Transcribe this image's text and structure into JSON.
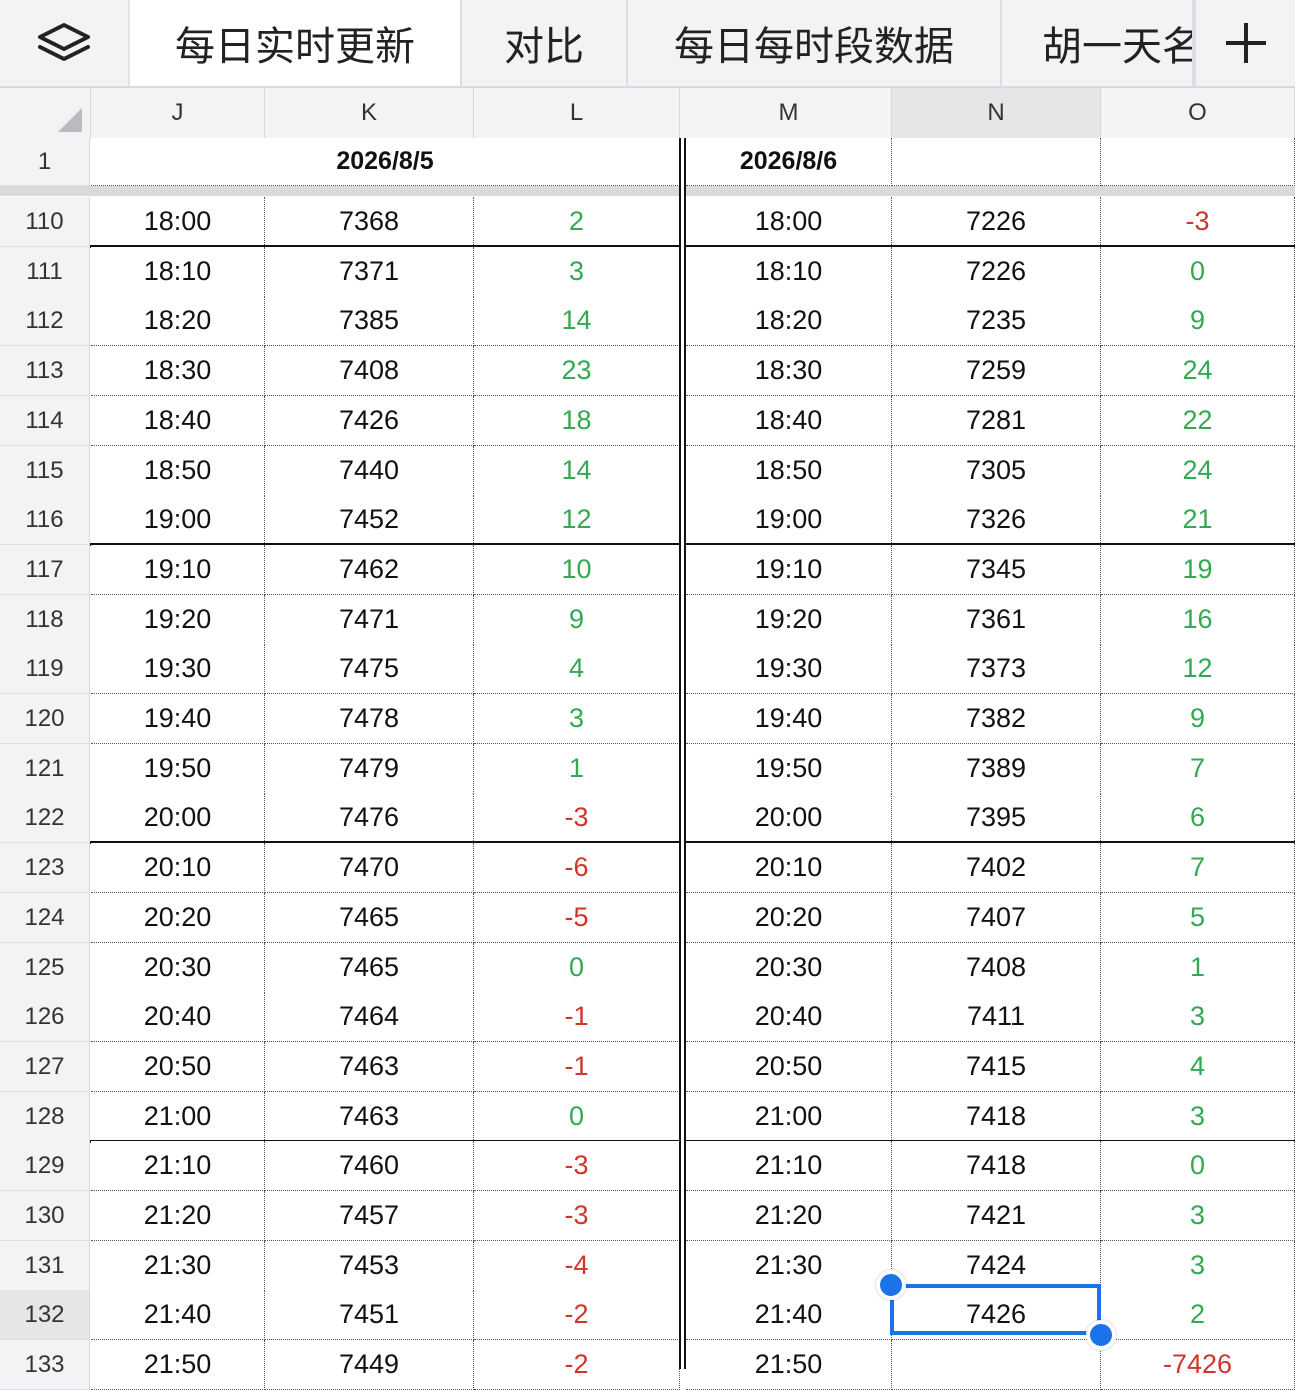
{
  "tabs": [
    {
      "label": "每日实时更新",
      "active": true
    },
    {
      "label": "对比",
      "active": false
    },
    {
      "label": "每日每时段数据",
      "active": false
    },
    {
      "label": "胡一天名",
      "active": false
    }
  ],
  "toolbar": {
    "menu_icon": "layers-icon",
    "add_icon": "plus-icon"
  },
  "columns": [
    "J",
    "K",
    "L",
    "M",
    "N",
    "O"
  ],
  "selected_column": "N",
  "selected_row": "132",
  "header_row": {
    "num": "1",
    "date1": "2026/8/5",
    "date2": "2026/8/6"
  },
  "rows": [
    {
      "num": "110",
      "t1": "18:00",
      "v1": "7368",
      "d1": "2",
      "t2": "18:00",
      "v2": "7226",
      "d2": "-3"
    },
    {
      "num": "111",
      "t1": "18:10",
      "v1": "7371",
      "d1": "3",
      "t2": "18:10",
      "v2": "7226",
      "d2": "0"
    },
    {
      "num": "112",
      "t1": "18:20",
      "v1": "7385",
      "d1": "14",
      "t2": "18:20",
      "v2": "7235",
      "d2": "9"
    },
    {
      "num": "113",
      "t1": "18:30",
      "v1": "7408",
      "d1": "23",
      "t2": "18:30",
      "v2": "7259",
      "d2": "24"
    },
    {
      "num": "114",
      "t1": "18:40",
      "v1": "7426",
      "d1": "18",
      "t2": "18:40",
      "v2": "7281",
      "d2": "22"
    },
    {
      "num": "115",
      "t1": "18:50",
      "v1": "7440",
      "d1": "14",
      "t2": "18:50",
      "v2": "7305",
      "d2": "24"
    },
    {
      "num": "116",
      "t1": "19:00",
      "v1": "7452",
      "d1": "12",
      "t2": "19:00",
      "v2": "7326",
      "d2": "21"
    },
    {
      "num": "117",
      "t1": "19:10",
      "v1": "7462",
      "d1": "10",
      "t2": "19:10",
      "v2": "7345",
      "d2": "19"
    },
    {
      "num": "118",
      "t1": "19:20",
      "v1": "7471",
      "d1": "9",
      "t2": "19:20",
      "v2": "7361",
      "d2": "16"
    },
    {
      "num": "119",
      "t1": "19:30",
      "v1": "7475",
      "d1": "4",
      "t2": "19:30",
      "v2": "7373",
      "d2": "12"
    },
    {
      "num": "120",
      "t1": "19:40",
      "v1": "7478",
      "d1": "3",
      "t2": "19:40",
      "v2": "7382",
      "d2": "9"
    },
    {
      "num": "121",
      "t1": "19:50",
      "v1": "7479",
      "d1": "1",
      "t2": "19:50",
      "v2": "7389",
      "d2": "7"
    },
    {
      "num": "122",
      "t1": "20:00",
      "v1": "7476",
      "d1": "-3",
      "t2": "20:00",
      "v2": "7395",
      "d2": "6"
    },
    {
      "num": "123",
      "t1": "20:10",
      "v1": "7470",
      "d1": "-6",
      "t2": "20:10",
      "v2": "7402",
      "d2": "7"
    },
    {
      "num": "124",
      "t1": "20:20",
      "v1": "7465",
      "d1": "-5",
      "t2": "20:20",
      "v2": "7407",
      "d2": "5"
    },
    {
      "num": "125",
      "t1": "20:30",
      "v1": "7465",
      "d1": "0",
      "t2": "20:30",
      "v2": "7408",
      "d2": "1"
    },
    {
      "num": "126",
      "t1": "20:40",
      "v1": "7464",
      "d1": "-1",
      "t2": "20:40",
      "v2": "7411",
      "d2": "3"
    },
    {
      "num": "127",
      "t1": "20:50",
      "v1": "7463",
      "d1": "-1",
      "t2": "20:50",
      "v2": "7415",
      "d2": "4"
    },
    {
      "num": "128",
      "t1": "21:00",
      "v1": "7463",
      "d1": "0",
      "t2": "21:00",
      "v2": "7418",
      "d2": "3"
    },
    {
      "num": "129",
      "t1": "21:10",
      "v1": "7460",
      "d1": "-3",
      "t2": "21:10",
      "v2": "7418",
      "d2": "0"
    },
    {
      "num": "130",
      "t1": "21:20",
      "v1": "7457",
      "d1": "-3",
      "t2": "21:20",
      "v2": "7421",
      "d2": "3"
    },
    {
      "num": "131",
      "t1": "21:30",
      "v1": "7453",
      "d1": "-4",
      "t2": "21:30",
      "v2": "7424",
      "d2": "3"
    },
    {
      "num": "132",
      "t1": "21:40",
      "v1": "7451",
      "d1": "-2",
      "t2": "21:40",
      "v2": "7426",
      "d2": "2"
    },
    {
      "num": "133",
      "t1": "21:50",
      "v1": "7449",
      "d1": "-2",
      "t2": "21:50",
      "v2": "",
      "d2": "-7426"
    }
  ],
  "hour_breaks_after": [
    "110",
    "116",
    "122",
    "128"
  ],
  "colors": {
    "positive": "#34a853",
    "negative": "#d0352c",
    "selection": "#1a73e8"
  }
}
